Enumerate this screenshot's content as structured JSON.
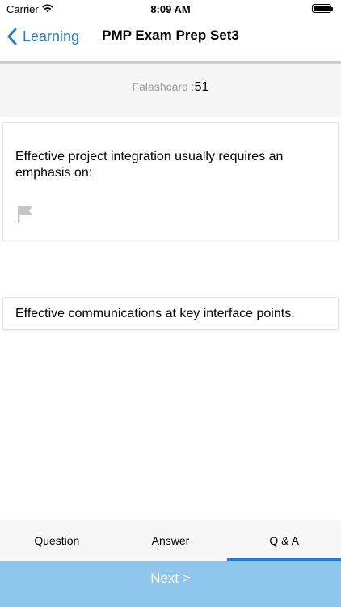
{
  "status_bar": {
    "carrier": "Carrier",
    "time": "8:09 AM"
  },
  "nav": {
    "back_label": "Learning",
    "title": "PMP Exam Prep Set3"
  },
  "flashcard": {
    "label": "Falashcard :",
    "number": "51"
  },
  "question": {
    "text": "Effective project integration usually requires an emphasis on:",
    "flag_icon": "flag-icon"
  },
  "answer": {
    "text": "Effective communications at key interface points."
  },
  "tabs": [
    {
      "label": "Question",
      "active": false
    },
    {
      "label": "Answer",
      "active": false
    },
    {
      "label": "Q & A",
      "active": true
    }
  ],
  "next_button": {
    "label": "Next >"
  },
  "colors": {
    "accent": "#1f7fd8",
    "next_bg": "#8ec6ec",
    "flag": "#c4c4c4"
  }
}
